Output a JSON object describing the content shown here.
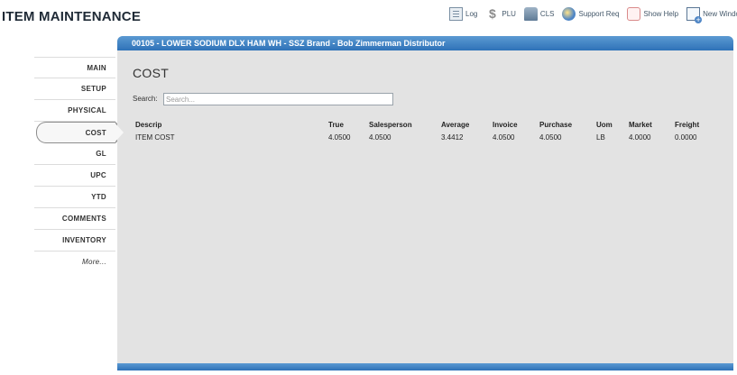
{
  "app": {
    "title": "ITEM MAINTENANCE"
  },
  "toolbar": [
    {
      "icon": "log-icon",
      "label": "Log"
    },
    {
      "icon": "dollar-icon",
      "label": "PLU"
    },
    {
      "icon": "cls-icon",
      "label": "CLS"
    },
    {
      "icon": "support-icon",
      "label": "Support Req"
    },
    {
      "icon": "help-icon",
      "label": "Show Help"
    },
    {
      "icon": "new-window-icon",
      "label": "New Window"
    }
  ],
  "sidebar": {
    "items": [
      "MAIN",
      "SETUP",
      "PHYSICAL",
      "COST",
      "GL",
      "UPC",
      "YTD",
      "COMMENTS",
      "INVENTORY"
    ],
    "active": "COST",
    "more_label": "More..."
  },
  "panel": {
    "header": "00105 - LOWER SODIUM DLX HAM WH - SSZ Brand - Bob Zimmerman Distributor",
    "section_title": "COST",
    "search": {
      "label": "Search:",
      "placeholder": "Search...",
      "value": ""
    }
  },
  "table": {
    "columns": [
      "Descrip",
      "True",
      "Salesperson",
      "Average",
      "Invoice",
      "Purchase",
      "Uom",
      "Market",
      "Freight"
    ],
    "rows": [
      [
        "ITEM COST",
        "4.0500",
        "4.0500",
        "3.4412",
        "4.0500",
        "4.0500",
        "LB",
        "4.0000",
        "0.0000"
      ]
    ]
  },
  "colors": {
    "header_blue": "#2f72b8",
    "panel_bg": "#e3e3e3"
  }
}
